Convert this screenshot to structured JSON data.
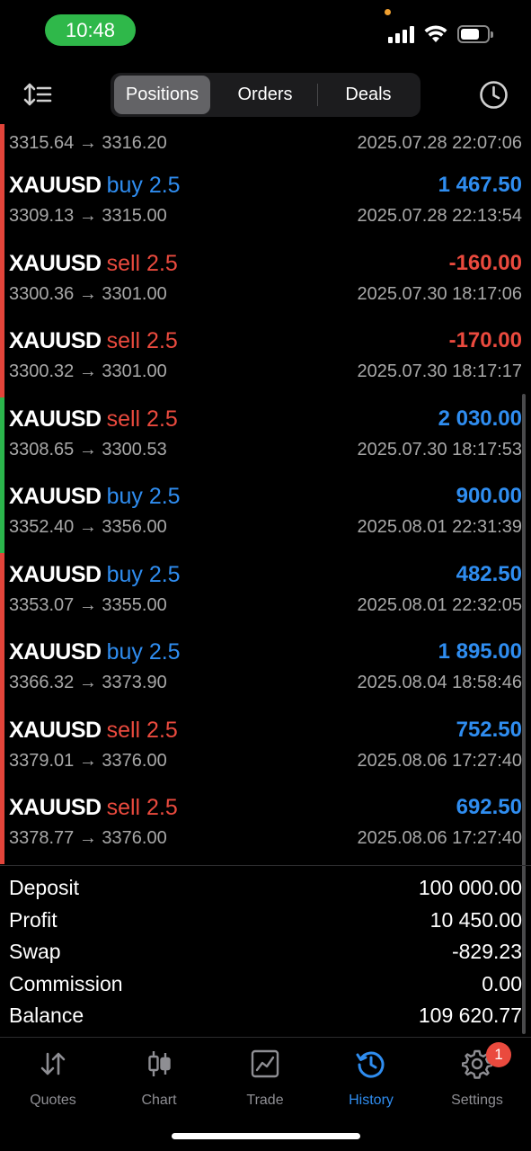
{
  "status_bar": {
    "time": "10:48"
  },
  "header": {
    "tabs": [
      {
        "label": "Positions",
        "active": true
      },
      {
        "label": "Orders",
        "active": false
      },
      {
        "label": "Deals",
        "active": false
      }
    ],
    "icons": {
      "left": "sort-icon",
      "right": "clock-history-icon"
    }
  },
  "colors": {
    "buy": "#2f8df0",
    "sell": "#ea4a3e",
    "profit_positive": "#2f8df0",
    "profit_negative": "#ea4a3e",
    "marker_red": "#e2443a",
    "marker_green": "#2bb54c",
    "accent": "#2f8df0"
  },
  "positions": [
    {
      "partial": true,
      "prices": "3315.64 → 3316.20",
      "datetime": "2025.07.28 22:07:06",
      "marker": "red"
    },
    {
      "symbol": "XAUUSD",
      "side": "buy 2.5",
      "side_type": "buy",
      "profit": "1 467.50",
      "profit_type": "pos",
      "prices": "3309.13 → 3315.00",
      "datetime": "2025.07.28 22:13:54",
      "marker": "red"
    },
    {
      "symbol": "XAUUSD",
      "side": "sell 2.5",
      "side_type": "sell",
      "profit": "-160.00",
      "profit_type": "neg",
      "prices": "3300.36 → 3301.00",
      "datetime": "2025.07.30 18:17:06",
      "marker": "red"
    },
    {
      "symbol": "XAUUSD",
      "side": "sell 2.5",
      "side_type": "sell",
      "profit": "-170.00",
      "profit_type": "neg",
      "prices": "3300.32 → 3301.00",
      "datetime": "2025.07.30 18:17:17",
      "marker": "red"
    },
    {
      "symbol": "XAUUSD",
      "side": "sell 2.5",
      "side_type": "sell",
      "profit": "2 030.00",
      "profit_type": "pos",
      "prices": "3308.65 → 3300.53",
      "datetime": "2025.07.30 18:17:53",
      "marker": "green"
    },
    {
      "symbol": "XAUUSD",
      "side": "buy 2.5",
      "side_type": "buy",
      "profit": "900.00",
      "profit_type": "pos",
      "prices": "3352.40 → 3356.00",
      "datetime": "2025.08.01 22:31:39",
      "marker": "green"
    },
    {
      "symbol": "XAUUSD",
      "side": "buy 2.5",
      "side_type": "buy",
      "profit": "482.50",
      "profit_type": "pos",
      "prices": "3353.07 → 3355.00",
      "datetime": "2025.08.01 22:32:05",
      "marker": "red"
    },
    {
      "symbol": "XAUUSD",
      "side": "buy 2.5",
      "side_type": "buy",
      "profit": "1 895.00",
      "profit_type": "pos",
      "prices": "3366.32 → 3373.90",
      "datetime": "2025.08.04 18:58:46",
      "marker": "red"
    },
    {
      "symbol": "XAUUSD",
      "side": "sell 2.5",
      "side_type": "sell",
      "profit": "752.50",
      "profit_type": "pos",
      "prices": "3379.01 → 3376.00",
      "datetime": "2025.08.06 17:27:40",
      "marker": "red"
    },
    {
      "symbol": "XAUUSD",
      "side": "sell 2.5",
      "side_type": "sell",
      "profit": "692.50",
      "profit_type": "pos",
      "prices": "3378.77 → 3376.00",
      "datetime": "2025.08.06 17:27:40",
      "marker": "red"
    }
  ],
  "summary": [
    {
      "label": "Deposit",
      "value": "100 000.00"
    },
    {
      "label": "Profit",
      "value": "10 450.00"
    },
    {
      "label": "Swap",
      "value": "-829.23"
    },
    {
      "label": "Commission",
      "value": "0.00"
    },
    {
      "label": "Balance",
      "value": "109 620.77"
    }
  ],
  "tabbar": {
    "items": [
      {
        "label": "Quotes",
        "icon": "quotes-arrows-icon",
        "active": false
      },
      {
        "label": "Chart",
        "icon": "candlestick-chart-icon",
        "active": false
      },
      {
        "label": "Trade",
        "icon": "trade-chart-icon",
        "active": false
      },
      {
        "label": "History",
        "icon": "history-clock-icon",
        "active": true
      },
      {
        "label": "Settings",
        "icon": "gear-icon",
        "active": false
      }
    ],
    "settings_badge": "1"
  }
}
